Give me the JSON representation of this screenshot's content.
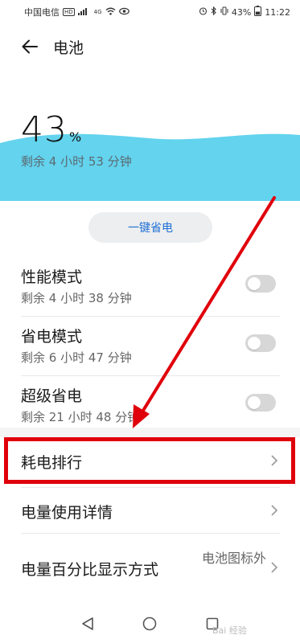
{
  "status_bar": {
    "carrier": "中国电信",
    "net_badge": "HD",
    "signal_label": "4G",
    "battery_percent": "43%",
    "time": "11:22"
  },
  "header": {
    "title": "电池"
  },
  "battery": {
    "percent_number": "43",
    "percent_unit": "%",
    "remaining": "剩余 4 小时 53 分钟",
    "wave_color": "#63d3ee"
  },
  "power_save_button": {
    "label": "一键省电"
  },
  "modes": [
    {
      "title": "性能模式",
      "remaining": "剩余 4 小时 38 分钟",
      "enabled": false
    },
    {
      "title": "省电模式",
      "remaining": "剩余 6 小时 47 分钟",
      "enabled": false
    },
    {
      "title": "超级省电",
      "remaining": "剩余 21 小时 48 分钟",
      "enabled": false
    }
  ],
  "list": [
    {
      "label": "耗电排行"
    },
    {
      "label": "电量使用详情"
    },
    {
      "label": "电量百分比显示方式",
      "value": "电池图标外"
    }
  ],
  "annotation": {
    "highlight_color": "#e0000b"
  },
  "watermark": "Bai 经验"
}
